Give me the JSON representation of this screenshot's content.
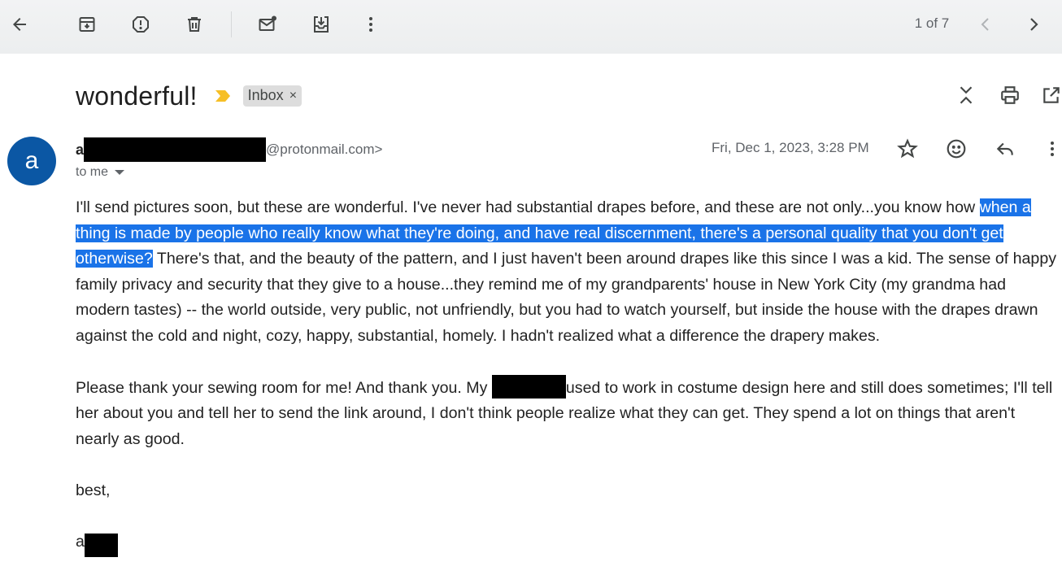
{
  "toolbar": {
    "back": "arrow-back-icon",
    "archive": "archive-icon",
    "spam": "report-spam-icon",
    "delete": "delete-icon",
    "mark_unread": "mark-unread-icon",
    "move_to": "move-to-inbox-icon",
    "more": "more-vert-icon",
    "pager_text": "1 of 7"
  },
  "email": {
    "subject": "wonderful!",
    "label": "Inbox",
    "label_remove": "×",
    "sender_initial": "a",
    "sender_email_suffix": "@protonmail.com>",
    "recipient": "to me",
    "date": "Fri, Dec 1, 2023, 3:28 PM",
    "avatar_letter": "a",
    "body": {
      "p1_start": "I'll send pictures soon, but these are wonderful. I've never had substantial drapes before, and these are not only...you know how ",
      "p1_selected": "when a thing is made by people who really know what they're doing, and have real discernment, there's a personal quality that you don't get otherwise?",
      "p1_end": " There's that, and the beauty of the pattern, and I just haven't been around drapes like this since I was a kid. The sense of happy family privacy and security that they give to a house...they remind me of my grandparents' house in New York City (my grandma had modern tastes) -- the world outside, very public, not unfriendly, but you had to watch yourself, but inside the house with the drapes drawn against the cold and night, cozy, happy, substantial, homely. I hadn't realized what a difference the drapery makes.",
      "p2_start": "Please thank your sewing room for me! And thank you. My ",
      "p2_end": "used to work in costume design here and still does sometimes; I'll tell her about you and tell her to send the link around, I don't think people realize what they can get. They spend a lot on things that aren't nearly as good.",
      "closing": "best,",
      "signature_initial": "a"
    }
  },
  "colors": {
    "accent_selection": "#1a73e8",
    "avatar_bg": "#0b57a4",
    "importance_marker": "#f6bf26",
    "redaction": "#000000"
  }
}
